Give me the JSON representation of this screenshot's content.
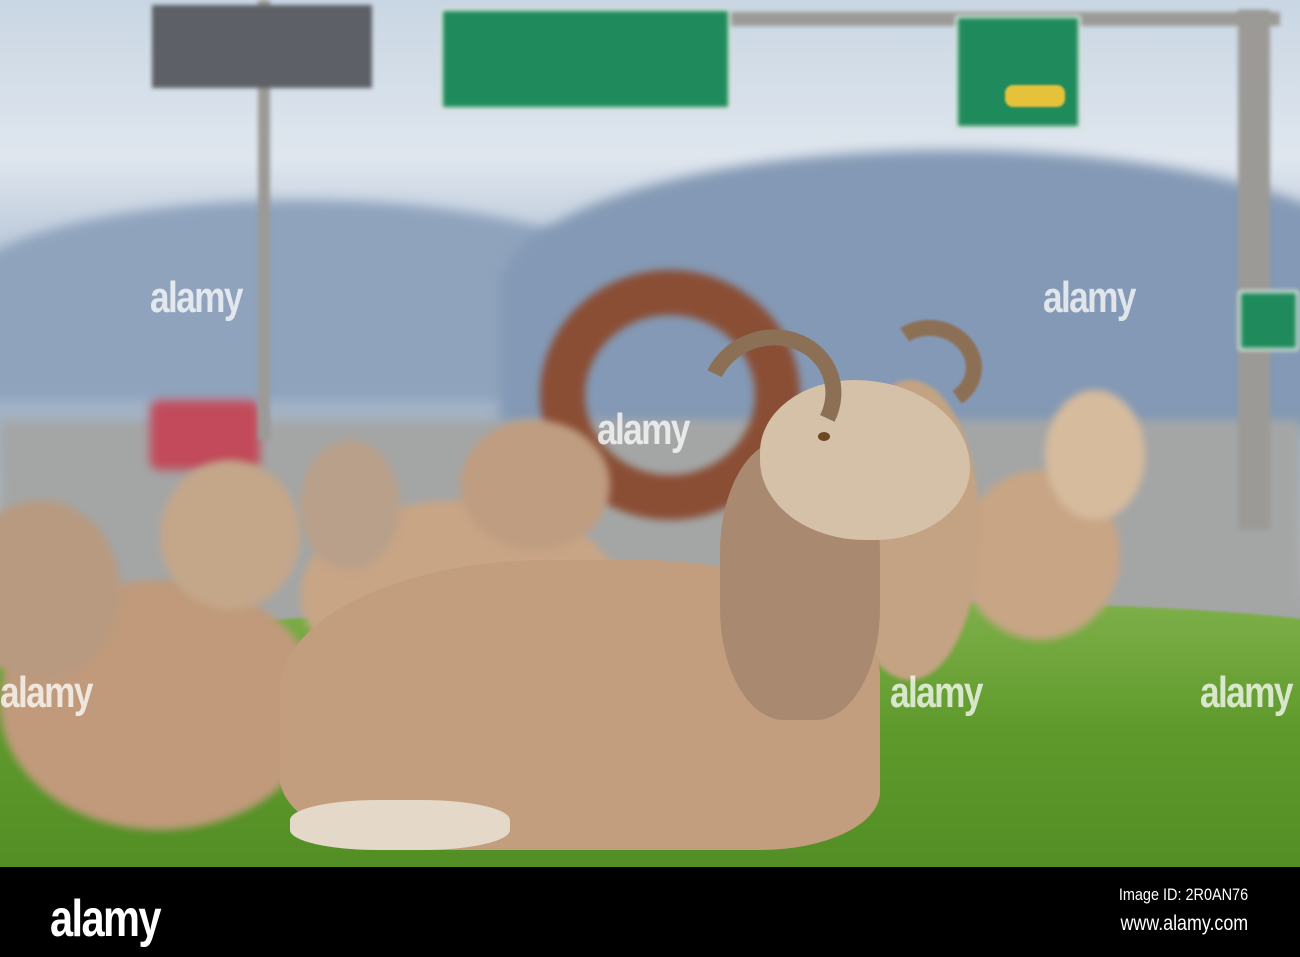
{
  "watermark": {
    "text": "alamy"
  },
  "footer": {
    "logo": "alamy",
    "image_id": "Image ID: 2R0AN76",
    "url": "www.alamy.com"
  },
  "colors": {
    "grass": "#5f9a2c",
    "sheep": "#c8a585",
    "sign": "#1f8a5c",
    "footer": "#000000"
  }
}
